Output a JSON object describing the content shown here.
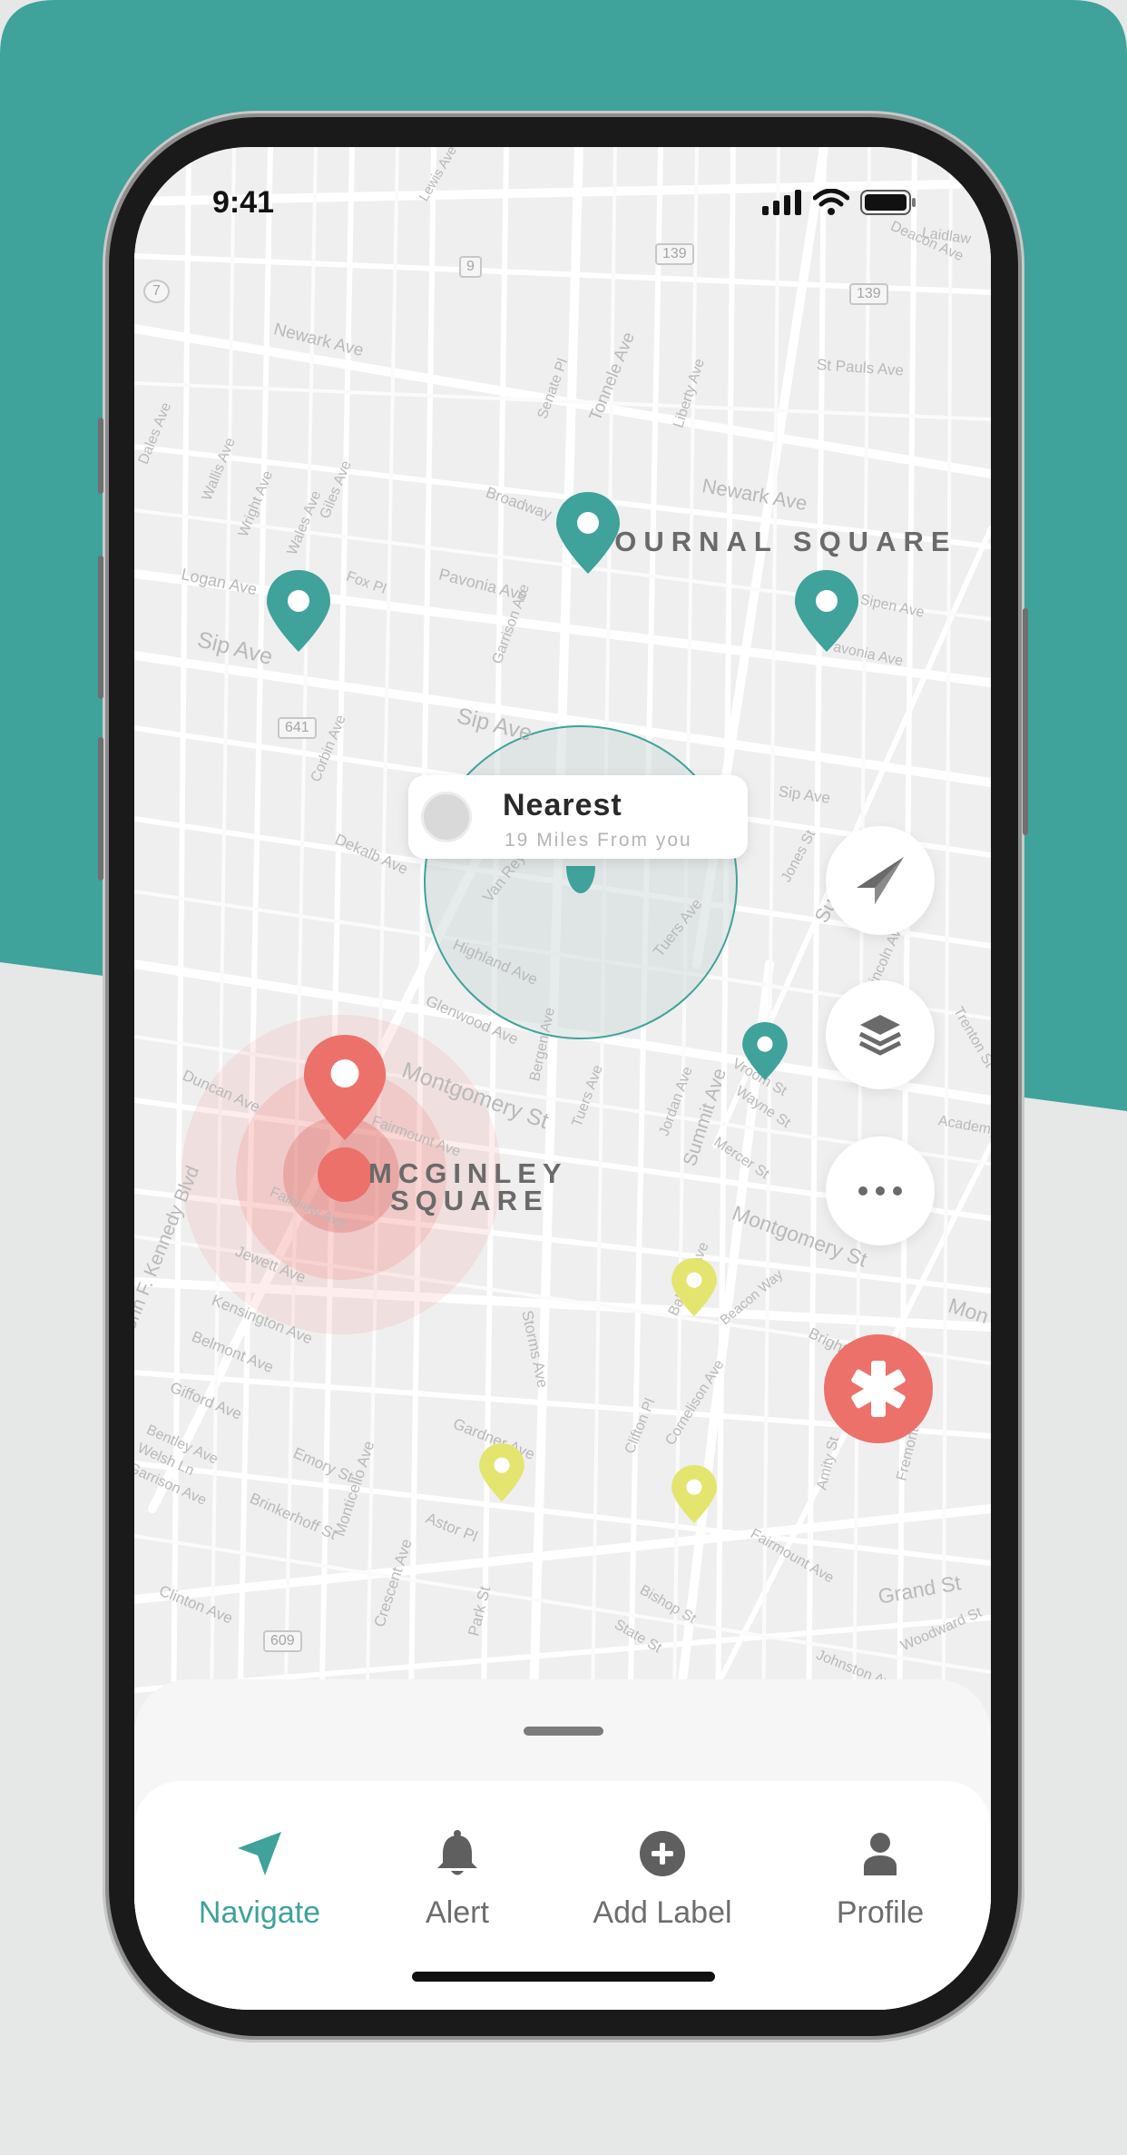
{
  "status_bar": {
    "time": "9:41"
  },
  "map": {
    "area_labels": {
      "journal": "JOURNAL SQUARE",
      "mcginley_1": "MCGINLEY",
      "mcginley_2": "SQUARE"
    },
    "highways": [
      "7",
      "9",
      "139",
      "139",
      "641",
      "609"
    ],
    "streets": [
      "Newark Ave",
      "Tonnele Ave",
      "Senate Pl",
      "Liberty Ave",
      "St Pauls Ave",
      "Newark Ave",
      "Broadway",
      "Pavonia Ave",
      "Logan Ave",
      "Sip Ave",
      "Wallis Ave",
      "Wright Ave",
      "Wales Ave",
      "Giles Ave",
      "Fox Pl",
      "Garrison Ave",
      "Sip Ave",
      "Corbin Ave",
      "Dekalb Ave",
      "Van Reypen",
      "Highland Ave",
      "Glenwood Ave",
      "Summit Ave",
      "Jones St",
      "Sip Ave",
      "Tuers Ave",
      "Montgomery St",
      "Duncan Ave",
      "John F. Kennedy Blvd",
      "Fairmount Ave",
      "Fairview Ave",
      "Jewett Ave",
      "Kensington Ave",
      "Belmont Ave",
      "Gifford Ave",
      "Bentley Ave",
      "Welsh Ln",
      "Garrison Ave",
      "Emory St",
      "Brinkerhoff St",
      "Monticello Ave",
      "Crescent Ave",
      "Astor Pl",
      "Gardner Ave",
      "Clinton Ave",
      "Park St",
      "Storms Ave",
      "Bergen Ave",
      "Tuers Ave",
      "Jordan Ave",
      "Summit Ave",
      "Wayne St",
      "Mercer St",
      "Montgomery St",
      "Baldwin Ave",
      "Beacon Way",
      "Clifton Pl",
      "Cornelison Ave",
      "Fairmount Ave",
      "Bishop St",
      "State St",
      "Amity St",
      "Fremont St",
      "Grand St",
      "Woodward St",
      "Johnston Ave",
      "Academy St",
      "Trenton St",
      "Lincoln Ave",
      "Pavonia Ave",
      "Sipen Ave",
      "Laidlaw",
      "Lewis Ave",
      "Deacon Ave",
      "Dales Ave",
      "Bright St",
      "Vroom St",
      "Mon"
    ]
  },
  "nearest": {
    "title": "Nearest",
    "subtitle": "19 Miles From you"
  },
  "tabs": {
    "navigate": "Navigate",
    "alert": "Alert",
    "add_label": "Add Label",
    "profile": "Profile"
  },
  "colors": {
    "teal": "#3fa29b",
    "red": "#ec716a",
    "yellow": "#e4e56e",
    "background": "#e6e7e7"
  }
}
